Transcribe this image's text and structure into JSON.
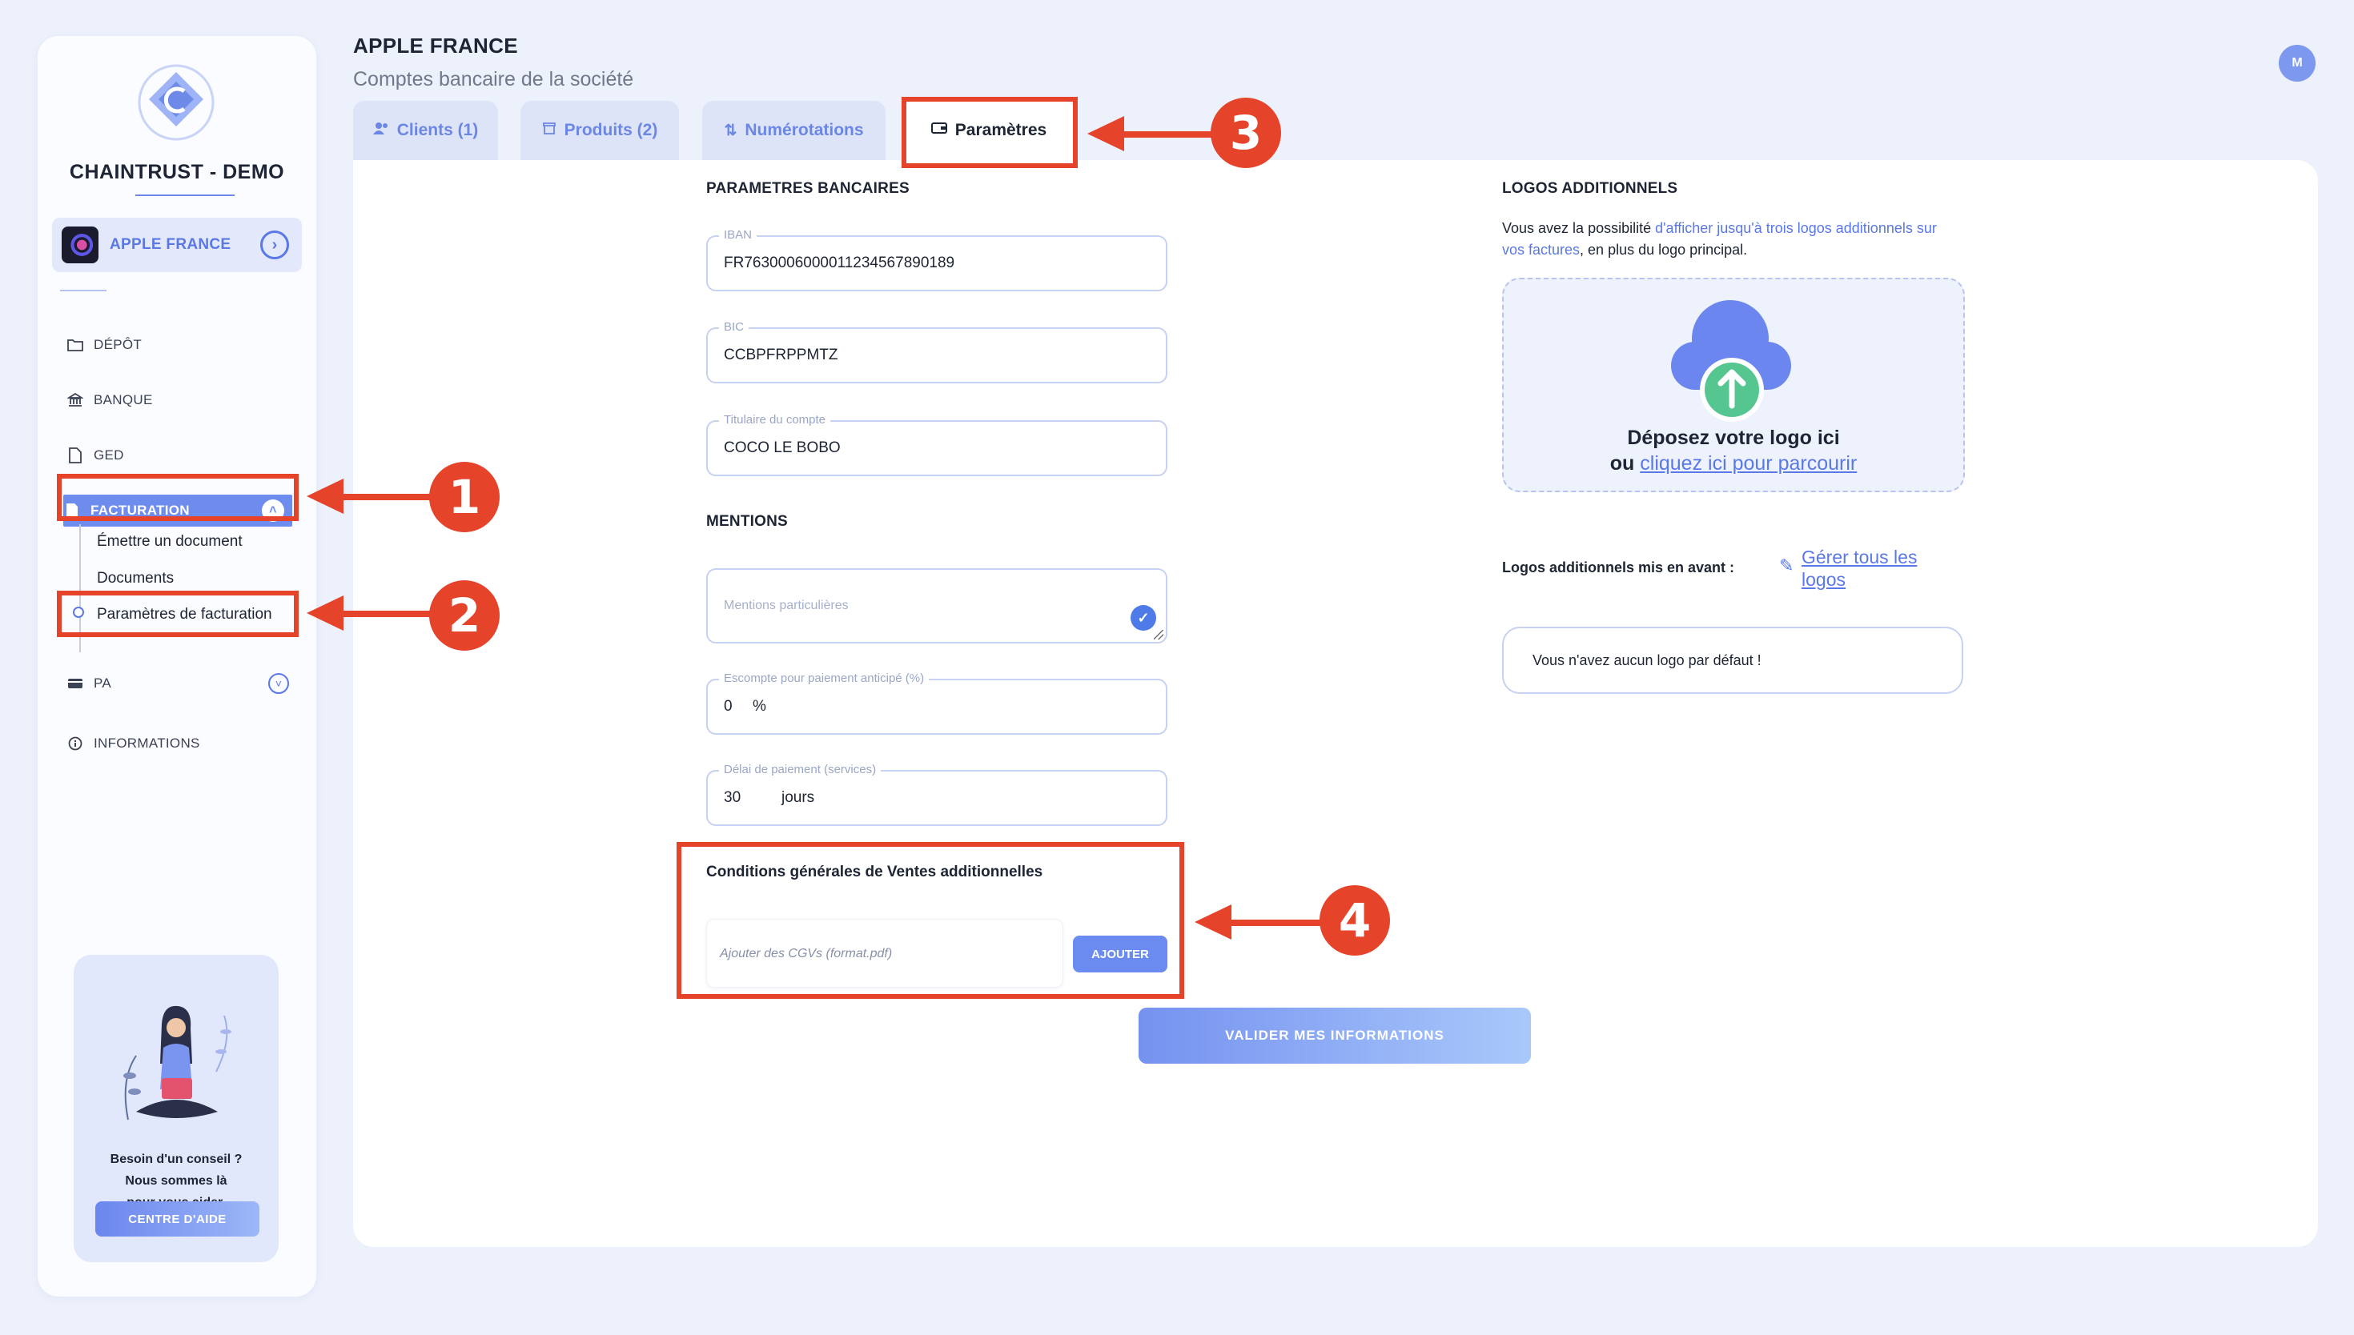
{
  "sidebar": {
    "brand": "CHAINTRUST - DEMO",
    "company": "APPLE FRANCE",
    "nav": {
      "depot": "DÉPÔT",
      "banque": "BANQUE",
      "ged": "GED",
      "facturation": "FACTURATION",
      "pa": "PA",
      "informations": "INFORMATIONS"
    },
    "facturation_sub": [
      "Émettre un document",
      "Documents",
      "Paramètres de facturation"
    ],
    "help": {
      "line1": "Besoin d'un conseil ?",
      "line2": "Nous sommes là",
      "line3": "pour vous aider.",
      "button": "CENTRE D'AIDE"
    }
  },
  "header": {
    "title": "APPLE FRANCE",
    "subtitle": "Comptes bancaire de la société",
    "user_initial": "M"
  },
  "tabs": [
    {
      "label": "Clients (1)",
      "icon": "users-icon"
    },
    {
      "label": "Produits (2)",
      "icon": "box-icon"
    },
    {
      "label": "Numérotations",
      "icon": "sort-icon"
    },
    {
      "label": "Paramètres",
      "icon": "wallet-icon",
      "active": true
    }
  ],
  "bank": {
    "heading": "PARAMETRES BANCAIRES",
    "iban_label": "IBAN",
    "iban": "FR7630006000011234567890189",
    "bic_label": "BIC",
    "bic": "CCBPFRPPMTZ",
    "holder_label": "Titulaire du compte",
    "holder": "COCO LE BOBO"
  },
  "mentions": {
    "heading": "MENTIONS",
    "special_placeholder": "Mentions particulières",
    "discount_label": "Escompte pour paiement anticipé (%)",
    "discount_value": "0",
    "discount_unit": "%",
    "delay_label": "Délai de paiement (services)",
    "delay_value": "30",
    "delay_unit": "jours"
  },
  "cgv": {
    "title": "Conditions générales de Ventes additionnelles",
    "placeholder": "Ajouter des CGVs (format.pdf)",
    "add_button": "AJOUTER"
  },
  "validate_button": "VALIDER MES INFORMATIONS",
  "logos": {
    "heading": "LOGOS ADDITIONNELS",
    "desc_start": "Vous avez la possibilité ",
    "desc_link": "d'afficher jusqu'à trois logos additionnels sur vos factures",
    "desc_end": ", en plus du logo principal.",
    "drop_main": "Déposez votre logo ici",
    "drop_prefix": "ou ",
    "drop_link": "cliquez ici pour parcourir",
    "featured_label": "Logos additionnels mis en avant :",
    "manage_link": "Gérer tous les logos",
    "no_logo": "Vous n'avez aucun logo par défaut !"
  },
  "annotations": [
    "1",
    "2",
    "3",
    "4"
  ],
  "colors": {
    "accent": "#6e8bee",
    "annotation": "#e5432a",
    "background": "#edf1fc"
  }
}
